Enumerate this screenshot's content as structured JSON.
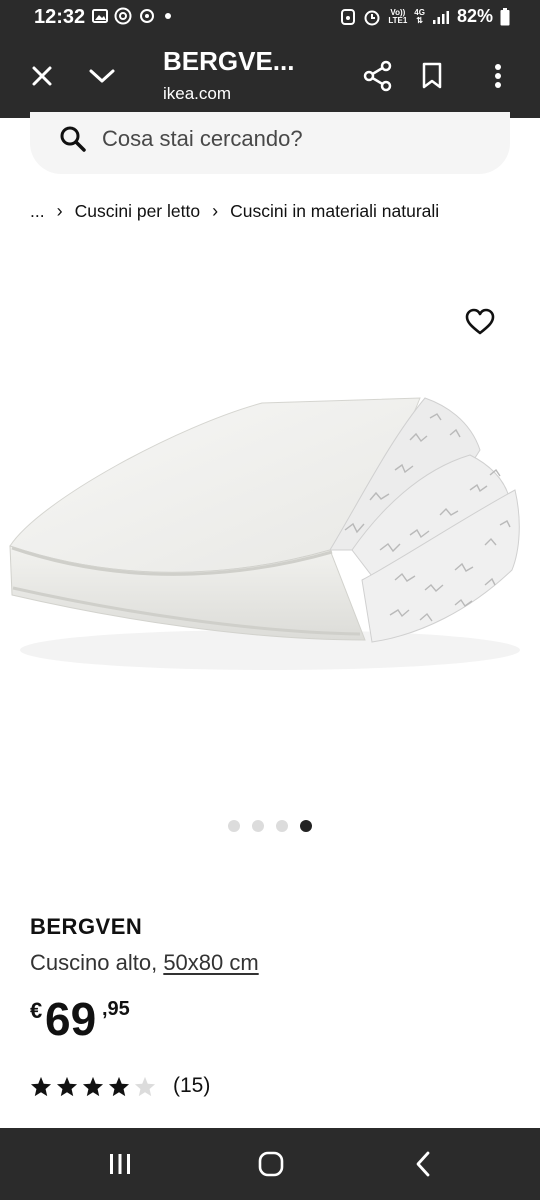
{
  "status_bar": {
    "time": "12:32",
    "battery": "82%",
    "volte_top": "Vo))",
    "volte_bottom": "LTE1",
    "network": "4G"
  },
  "toolbar": {
    "title": "BERGVE...",
    "url": "ikea.com"
  },
  "search": {
    "placeholder": "Cosa stai cercando?"
  },
  "breadcrumb": {
    "items": [
      "...",
      "Cuscini per letto",
      "Cuscini in materiali naturali"
    ]
  },
  "carousel": {
    "total": 4,
    "active": 4
  },
  "product": {
    "name": "BERGVEN",
    "type": "Cuscino alto,",
    "size": "50x80 cm",
    "price_currency": "€",
    "price_int": "69",
    "price_dec": ",95",
    "rating_stars": 4,
    "rating_max": 5,
    "reviews": "(15)"
  },
  "colors": {
    "dark_bar": "#2b2b2b",
    "search_bg": "#f5f5f5",
    "star_filled": "#111111",
    "star_empty": "#dcdcdc"
  }
}
